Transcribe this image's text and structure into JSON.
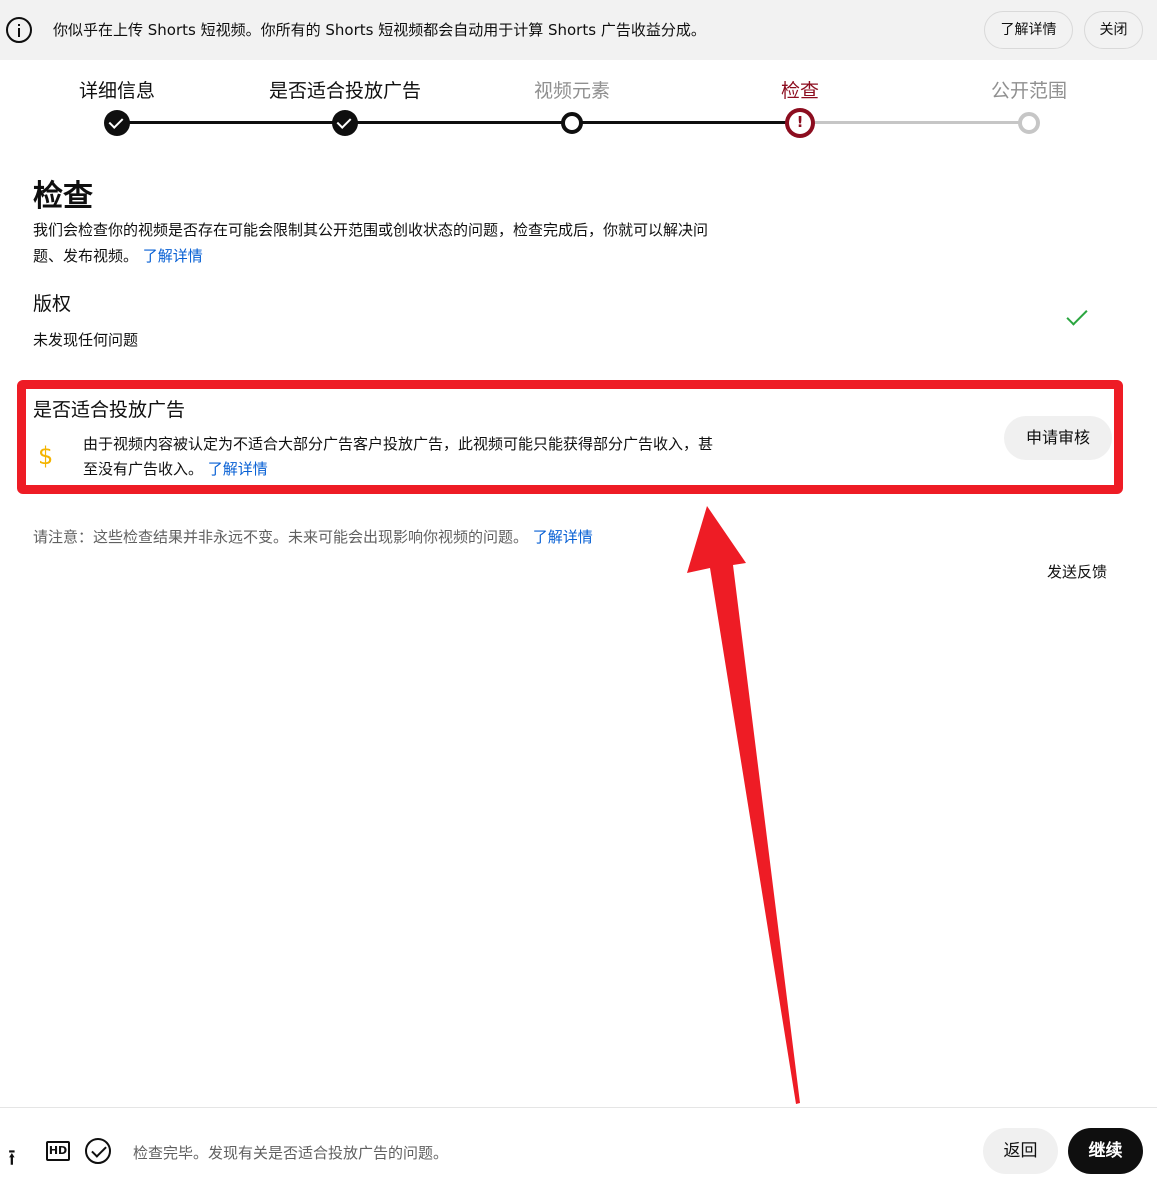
{
  "banner": {
    "text": "你似乎在上传 Shorts 短视频。你所有的 Shorts 短视频都会自动用于计算 Shorts 广告收益分成。",
    "learn_more": "了解详情",
    "close": "关闭"
  },
  "stepper": {
    "steps": [
      {
        "label": "详细信息",
        "state": "done"
      },
      {
        "label": "是否适合投放广告",
        "state": "done"
      },
      {
        "label": "视频元素",
        "state": "visited"
      },
      {
        "label": "检查",
        "state": "error"
      },
      {
        "label": "公开范围",
        "state": "upcoming"
      }
    ],
    "error_glyph": "!"
  },
  "main": {
    "title": "检查",
    "description": "我们会检查你的视频是否存在可能会限制其公开范围或创收状态的问题，检查完成后，你就可以解决问题、发布视频。",
    "description_link": "了解详情",
    "copyright": {
      "title": "版权",
      "status": "未发现任何问题",
      "icon": "check-icon"
    },
    "ad_suitability": {
      "title": "是否适合投放广告",
      "icon": "dollar-icon",
      "icon_glyph": "$",
      "message": "由于视频内容被认定为不适合大部分广告客户投放广告，此视频可能只能获得部分广告收入，甚至没有广告收入。",
      "link": "了解详情",
      "appeal_button": "申请审核"
    },
    "note": "请注意：这些检查结果并非永远不变。未来可能会出现影响你视频的问题。",
    "note_link": "了解详情",
    "feedback": "发送反馈"
  },
  "footer": {
    "upload_glyph": "⭱",
    "hd_label": "HD",
    "status": "检查完毕。发现有关是否适合投放广告的问题。",
    "back": "返回",
    "next": "继续"
  },
  "colors": {
    "error": "#8c0d1f",
    "link": "#065fd4",
    "highlight": "#ee1c25",
    "success": "#2ba640"
  }
}
